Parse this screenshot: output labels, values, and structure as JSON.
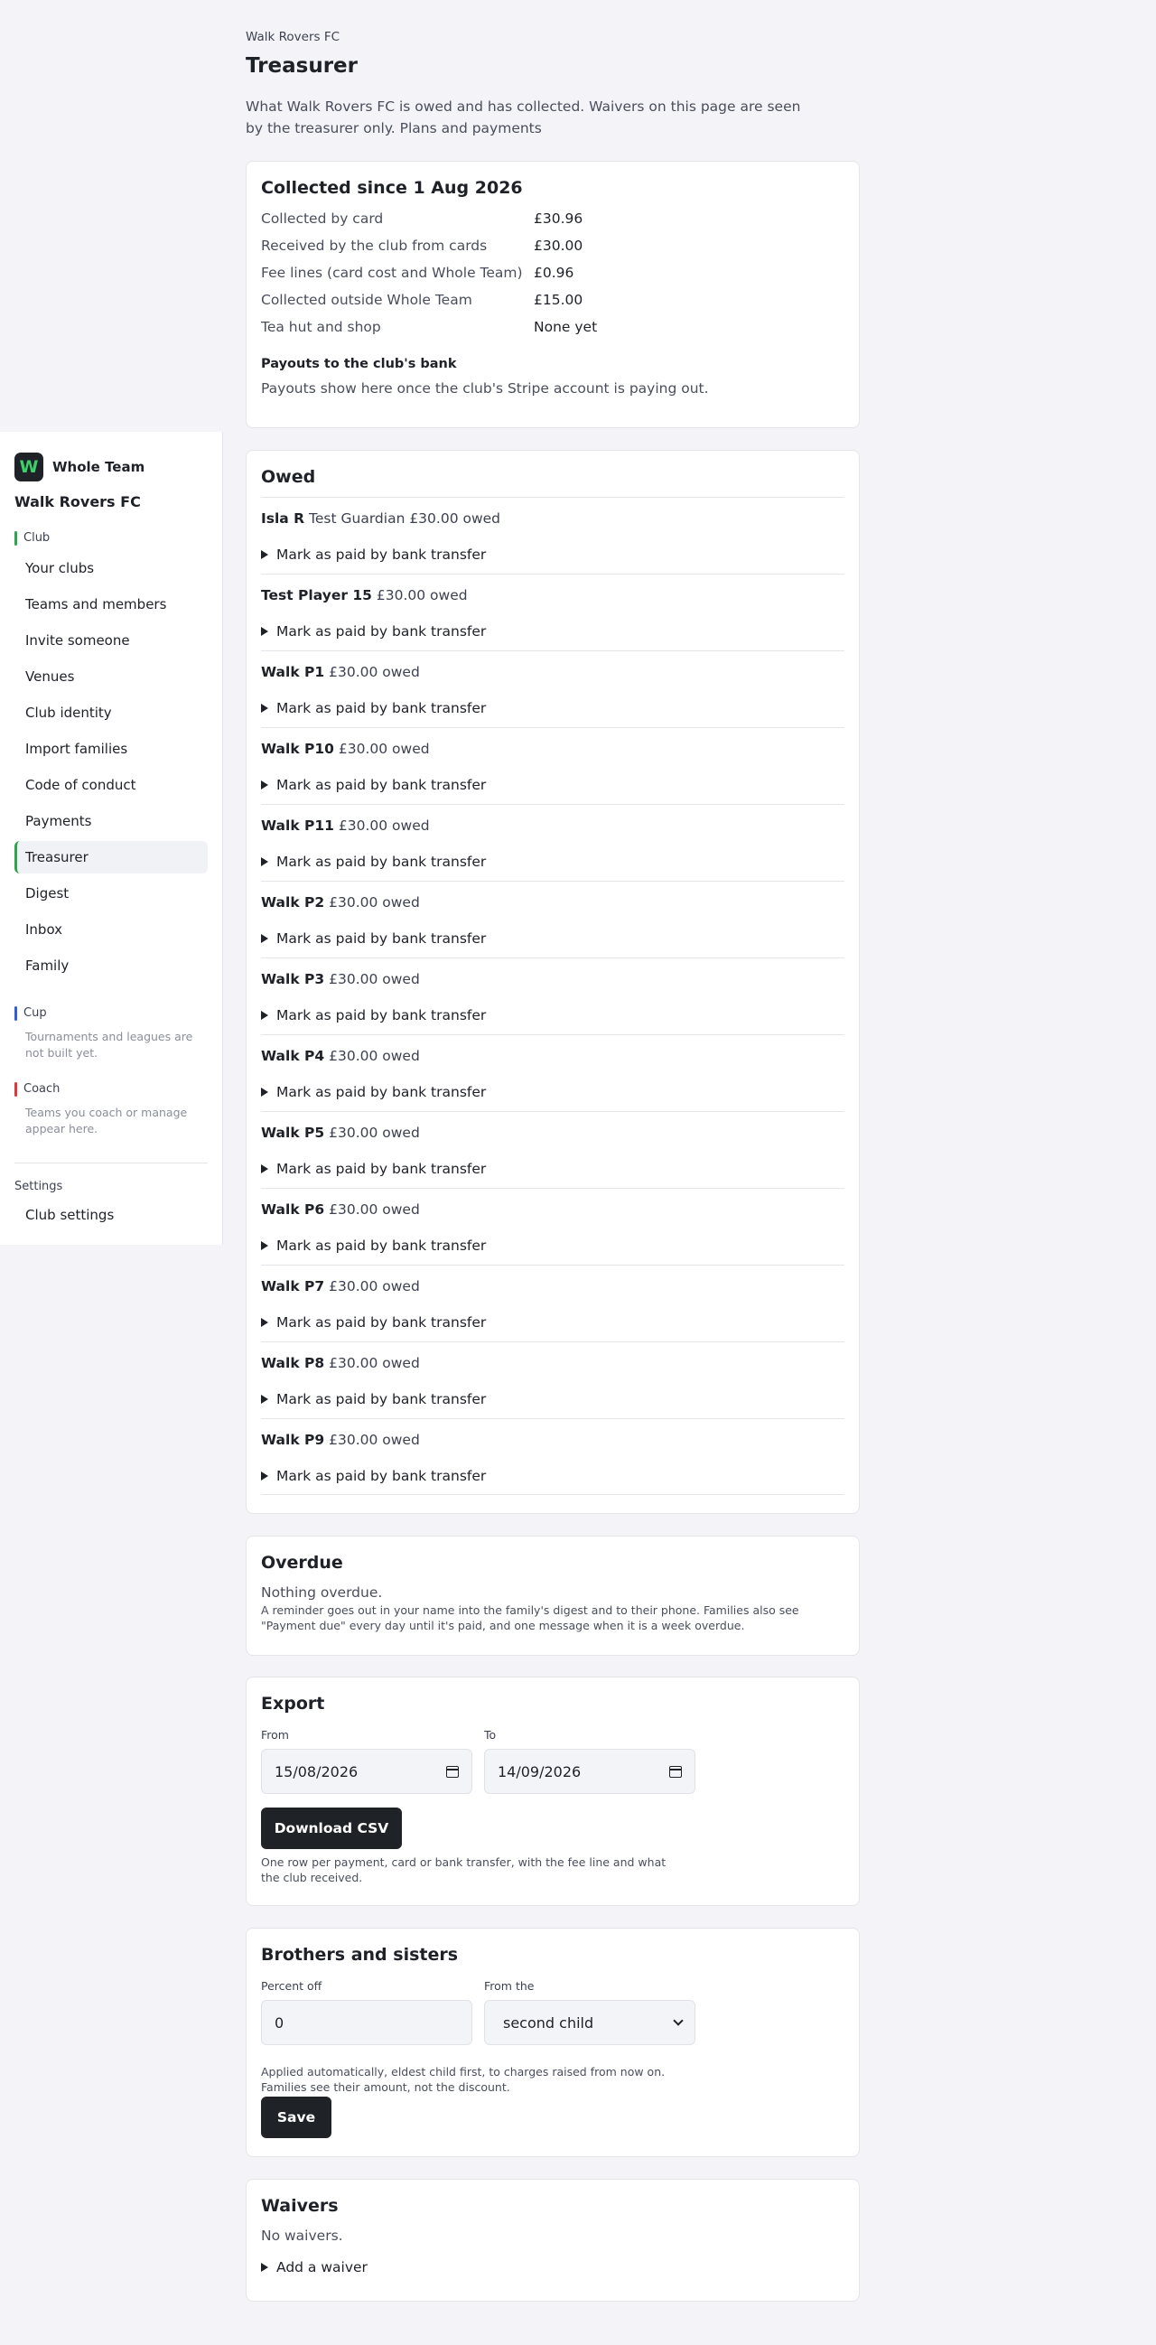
{
  "sidebar": {
    "brand": "Whole Team",
    "logo_letter": "W",
    "club": "Walk Rovers FC",
    "club_section": "Club",
    "items": [
      "Your clubs",
      "Teams and members",
      "Invite someone",
      "Venues",
      "Club identity",
      "Import families",
      "Code of conduct",
      "Payments",
      "Treasurer",
      "Digest",
      "Inbox",
      "Family"
    ],
    "active_item": "Treasurer",
    "cup_section": "Cup",
    "cup_note": "Tournaments and leagues are not built yet.",
    "coach_section": "Coach",
    "coach_note": "Teams you coach or manage appear here.",
    "settings_section": "Settings",
    "settings_item": "Club settings",
    "colors": {
      "club": "#2ea44f",
      "cup": "#2f5fd0",
      "coach": "#d93a3a"
    }
  },
  "header": {
    "eyebrow": "Walk Rovers FC",
    "title": "Treasurer",
    "intro": "What Walk Rovers FC is owed and has collected. Waivers on this page are seen by the treasurer only. Plans and payments"
  },
  "collected": {
    "title": "Collected since 1 Aug 2026",
    "rows": [
      {
        "label": "Collected by card",
        "value": "£30.96"
      },
      {
        "label": "Received by the club from cards",
        "value": "£30.00"
      },
      {
        "label": "Fee lines (card cost and Whole Team)",
        "value": "£0.96"
      },
      {
        "label": "Collected outside Whole Team",
        "value": "£15.00"
      },
      {
        "label": "Tea hut and shop",
        "value": "None yet"
      }
    ],
    "payouts_title": "Payouts to the club's bank",
    "payouts_note": "Payouts show here once the club's Stripe account is paying out."
  },
  "owed": {
    "title": "Owed",
    "action_label": "Mark as paid by bank transfer",
    "rows": [
      {
        "name": "Isla R",
        "detail": "Test Guardian £30.00 owed"
      },
      {
        "name": "Test Player 15",
        "detail": "£30.00 owed"
      },
      {
        "name": "Walk P1",
        "detail": "£30.00 owed"
      },
      {
        "name": "Walk P10",
        "detail": "£30.00 owed"
      },
      {
        "name": "Walk P11",
        "detail": "£30.00 owed"
      },
      {
        "name": "Walk P2",
        "detail": "£30.00 owed"
      },
      {
        "name": "Walk P3",
        "detail": "£30.00 owed"
      },
      {
        "name": "Walk P4",
        "detail": "£30.00 owed"
      },
      {
        "name": "Walk P5",
        "detail": "£30.00 owed"
      },
      {
        "name": "Walk P6",
        "detail": "£30.00 owed"
      },
      {
        "name": "Walk P7",
        "detail": "£30.00 owed"
      },
      {
        "name": "Walk P8",
        "detail": "£30.00 owed"
      },
      {
        "name": "Walk P9",
        "detail": "£30.00 owed"
      }
    ]
  },
  "overdue": {
    "title": "Overdue",
    "status": "Nothing overdue.",
    "note": "A reminder goes out in your name into the family's digest and to their phone. Families also see \"Payment due\" every day until it's paid, and one message when it is a week overdue."
  },
  "export": {
    "title": "Export",
    "from_label": "From",
    "from_value": "15/08/2026",
    "to_label": "To",
    "to_value": "14/09/2026",
    "button": "Download CSV",
    "note": "One row per payment, card or bank transfer, with the fee line and what the club received."
  },
  "siblings": {
    "title": "Brothers and sisters",
    "percent_label": "Percent off",
    "percent_value": "0",
    "from_label": "From the",
    "from_value": "second child",
    "note": "Applied automatically, eldest child first, to charges raised from now on. Families see their amount, not the discount.",
    "button": "Save"
  },
  "waivers": {
    "title": "Waivers",
    "status": "No waivers.",
    "action": "Add a waiver"
  }
}
